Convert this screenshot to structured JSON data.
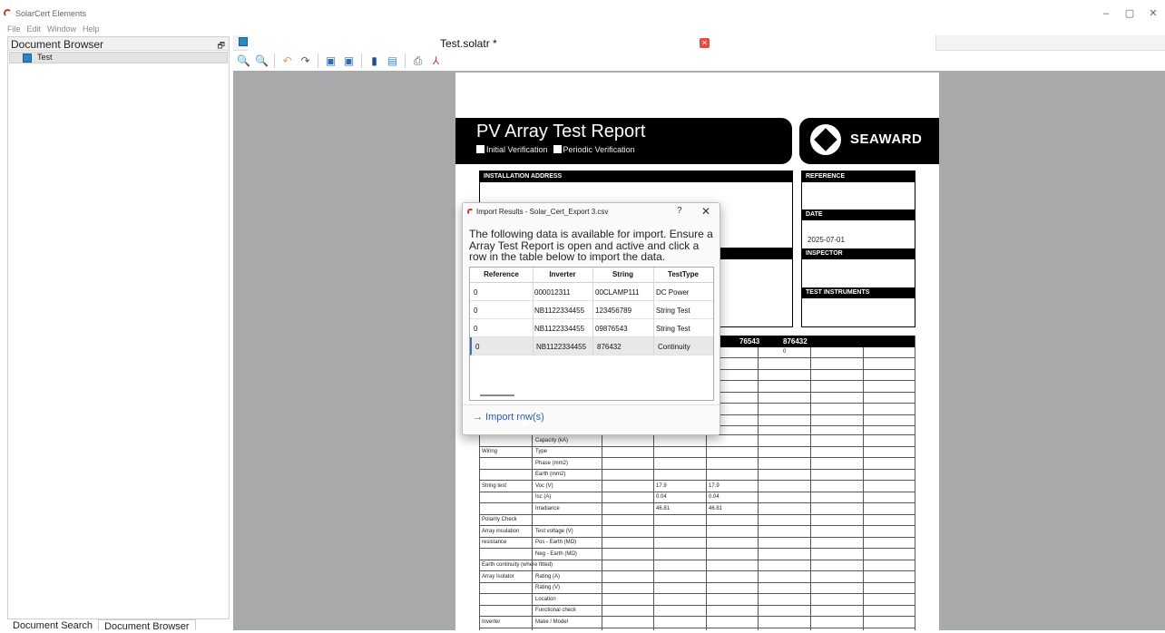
{
  "app": {
    "title": "SolarCert Elements",
    "window_controls": [
      "–",
      "▢",
      "✕"
    ]
  },
  "menu": [
    "File",
    "Edit",
    "Window",
    "Help"
  ],
  "left_panel": {
    "header": "Document Browser",
    "pin_glyph": "🗗",
    "tree": [
      {
        "label": "Test"
      }
    ],
    "bottom_tabs": [
      "Document Search",
      "Document Browser"
    ]
  },
  "document": {
    "tab_title": "Test.solatr *",
    "close_glyph": "✕",
    "toolbar_icons": [
      "zoom-in-icon",
      "zoom-out-icon",
      "undo-icon",
      "redo-icon",
      "save-icon",
      "save-as-icon",
      "import-icon",
      "template-icon",
      "print-icon",
      "pdf-icon"
    ]
  },
  "report": {
    "title": "PV Array Test Report",
    "option1": "Initial Verification",
    "option2": "Periodic Verification",
    "brand": "SEAWARD",
    "installation_address": "INSTALLATION ADDRESS",
    "reference": "REFERENCE",
    "date": "DATE",
    "date_value": "2025-07-01",
    "inspector": "INSPECTOR",
    "test_instruments": "TEST INSTRUMENTS",
    "grid_headers": [
      "76543",
      "876432"
    ],
    "grid_cell_0": "0",
    "rows": [
      {
        "a": "",
        "b": "",
        "c": "",
        "d": ""
      },
      {
        "a": "",
        "b": "Capacity (kA)",
        "c": "",
        "d": ""
      },
      {
        "a": "Wiring",
        "b": "Type",
        "c": "",
        "d": ""
      },
      {
        "a": "",
        "b": "Phase (mm2)",
        "c": "",
        "d": ""
      },
      {
        "a": "",
        "b": "Earth (mm2)",
        "c": "",
        "d": ""
      },
      {
        "a": "String test",
        "b": "Voc (V)",
        "c": "17.9",
        "d": "17.9"
      },
      {
        "a": "",
        "b": "Isc (A)",
        "c": "0.04",
        "d": "0.04"
      },
      {
        "a": "",
        "b": "Irradiance",
        "c": "46.81",
        "d": "46.81"
      },
      {
        "a": "Polarity Check",
        "b": "",
        "c": "",
        "d": ""
      },
      {
        "a": "Array insulation",
        "b": "Test voltage (V)",
        "c": "",
        "d": ""
      },
      {
        "a": "resistance",
        "b": "Pos - Earth (MΩ)",
        "c": "",
        "d": ""
      },
      {
        "a": "",
        "b": "Neg - Earth (MΩ)",
        "c": "",
        "d": ""
      },
      {
        "a": "Earth continuity (where fitted)",
        "b": "",
        "c": "",
        "d": ""
      },
      {
        "a": "Array Isolator",
        "b": "Rating (A)",
        "c": "",
        "d": ""
      },
      {
        "a": "",
        "b": "Rating (V)",
        "c": "",
        "d": ""
      },
      {
        "a": "",
        "b": "Location",
        "c": "",
        "d": ""
      },
      {
        "a": "",
        "b": "Functional check",
        "c": "",
        "d": ""
      },
      {
        "a": "Inverter",
        "b": "Make / Model",
        "c": "",
        "d": ""
      }
    ]
  },
  "dialog": {
    "title": "Import Results - Solar_Cert_Export 3.csv",
    "help": "?",
    "close": "✕",
    "message": "The following data is available for import. Ensure a Array Test Report is open and active and click a row in the table below to import the data.",
    "columns": [
      "Reference",
      "Inverter",
      "String",
      "TestType"
    ],
    "rows": [
      [
        "0",
        "000012311",
        "00CLAMP111",
        "DC Power"
      ],
      [
        "0",
        "NB1122334455",
        "123456789",
        "String Test"
      ],
      [
        "0",
        "NB1122334455",
        "09876543",
        "String Test"
      ],
      [
        "0",
        "NB1122334455",
        "876432",
        "Continuity"
      ]
    ],
    "import_label": "→ Import row(s)"
  }
}
